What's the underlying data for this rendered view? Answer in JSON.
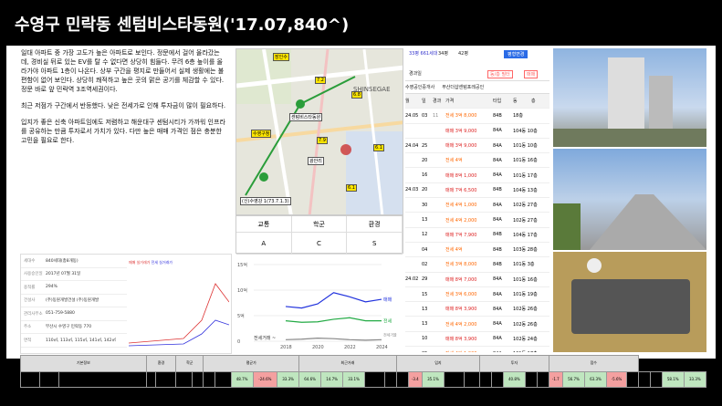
{
  "header": {
    "title": "수영구 민락동 센텀비스타동원('17.07,840^)"
  },
  "description": [
    "일대 아파트 중 가장 고도가 높은 아파트로 보인다. 정문에서 걸어 올라갔는데, 경비실 뒤로 있는 EV를 탈 수 없다면 상당히 힘들다. 무려 6층 높이를 올라가야 아파트 1층이 나온다. 상부 구간을 평지로 만들어서 실제 생활에는 불편함이 없어 보인다. 상당히 쾌적하고 높은 곳의 맑은 공기를 체감할 수 있다. 정문 바로 앞 민락역 3조역세권이다.",
    "최근 저점가 구간에서 반등했다. 낮은 전세가로 인해 투자금이 많이 필요하다.",
    "입지가 좋은 신축 아파트임에도 저렴하고 해운대구 센텀시티가 가까워 인프라를 공유하는 만큼 투자로서 가치가 있다. 다만 높은 매매 가격인 점은 충분한 고민을 필요로 한다."
  ],
  "map": {
    "tags": [
      {
        "id": "t1",
        "text": "장인수"
      },
      {
        "id": "t2",
        "text": "7.2"
      },
      {
        "id": "t3",
        "text": "6.8"
      },
      {
        "id": "t4",
        "text": "수영구청"
      },
      {
        "id": "t5",
        "text": "7.9"
      },
      {
        "id": "t6",
        "text": "센텀비스타동원"
      },
      {
        "id": "t7",
        "text": "6.1"
      },
      {
        "id": "t8",
        "text": "6.1"
      },
      {
        "id": "t9",
        "text": "(신)수영강 1(73.7.1.3)"
      },
      {
        "id": "t10",
        "text": "광안리"
      }
    ],
    "brand": "SHINSEGAE"
  },
  "grade": {
    "headers": [
      "교통",
      "학군",
      "환경"
    ],
    "values": [
      "A",
      "C",
      "S"
    ]
  },
  "deals": {
    "tabs": [
      "33평 661세대",
      "34평",
      "42평"
    ],
    "button": "평형변경",
    "filter": "경과일",
    "recommend": "동/층 필터",
    "sale_button": "매매",
    "realtors": [
      "수영공인중개사",
      "부산더샵센텀포레공인"
    ],
    "cols": [
      "월",
      "일",
      "경과",
      "가격",
      "타입",
      "동",
      "층"
    ],
    "rows": [
      {
        "d": "24.05",
        "day": "03",
        "ag": "11",
        "t": "전세",
        "p": "3억 8,000",
        "ty": "84B",
        "f": "18층"
      },
      {
        "d": "",
        "day": "",
        "ag": "",
        "t": "매매",
        "p": "3억 9,000",
        "ty": "84A",
        "f": "104동 10층"
      },
      {
        "d": "24.04",
        "day": "25",
        "ag": "",
        "t": "매매",
        "p": "3억 9,000",
        "ty": "84A",
        "f": "101동 10층"
      },
      {
        "d": "",
        "day": "20",
        "ag": "",
        "t": "전세",
        "p": "4억",
        "ty": "84A",
        "f": "101동 16층"
      },
      {
        "d": "",
        "day": "16",
        "ag": "",
        "t": "매매",
        "p": "8억 1,000",
        "ty": "84A",
        "f": "101동 17층"
      },
      {
        "d": "24.03",
        "day": "20",
        "ag": "",
        "t": "매매",
        "p": "7억 6,500",
        "ty": "84B",
        "f": "104동 13층"
      },
      {
        "d": "",
        "day": "30",
        "ag": "",
        "t": "전세",
        "p": "4억 1,000",
        "ty": "84A",
        "f": "102동 27층"
      },
      {
        "d": "",
        "day": "13",
        "ag": "",
        "t": "전세",
        "p": "4억 2,000",
        "ty": "84A",
        "f": "102동 27층"
      },
      {
        "d": "",
        "day": "12",
        "ag": "",
        "t": "매매",
        "p": "7억 7,900",
        "ty": "84B",
        "f": "104동 17층"
      },
      {
        "d": "",
        "day": "04",
        "ag": "",
        "t": "전세",
        "p": "4억",
        "ty": "84B",
        "f": "103동 28층"
      },
      {
        "d": "",
        "day": "02",
        "ag": "",
        "t": "전세",
        "p": "3억 8,000",
        "ty": "84B",
        "f": "101동 3층"
      },
      {
        "d": "24.02",
        "day": "29",
        "ag": "",
        "t": "매매",
        "p": "8억 7,000",
        "ty": "84A",
        "f": "101동 16층"
      },
      {
        "d": "",
        "day": "15",
        "ag": "",
        "t": "전세",
        "p": "3억 6,000",
        "ty": "84A",
        "f": "101동 19층"
      },
      {
        "d": "",
        "day": "13",
        "ag": "",
        "t": "매매",
        "p": "8억 3,900",
        "ty": "84A",
        "f": "102동 26층"
      },
      {
        "d": "",
        "day": "13",
        "ag": "",
        "t": "전세",
        "p": "4억 2,000",
        "ty": "84A",
        "f": "102동 26층"
      },
      {
        "d": "",
        "day": "10",
        "ag": "",
        "t": "매매",
        "p": "8억 3,900",
        "ty": "84A",
        "f": "102동 24층"
      },
      {
        "d": "",
        "day": "05",
        "ag": "",
        "t": "전세",
        "p": "4억 1,000",
        "ty": "84A",
        "f": "101동 17층"
      },
      {
        "d": "",
        "day": "",
        "ag": "",
        "t": "전세",
        "p": "3억 5,000",
        "ty": "84B",
        "f": "104동 13층"
      }
    ]
  },
  "info": {
    "rows": [
      {
        "k": "세대수",
        "v": "840세대(총8개동)",
        "k2": "저/최고층",
        "v2": "25층/29층"
      },
      {
        "k": "사용승인일",
        "v": "2017년 07월 31일",
        "k2": "용적률",
        "v2": ""
      },
      {
        "k": "용적률",
        "v": "294%",
        "k2": "건폐율",
        "v2": "16%"
      },
      {
        "k": "건설사",
        "v": "(주)동원개발건설 (주)동원개발",
        "k2": "",
        "v2": ""
      },
      {
        "k": "관리사무소",
        "v": "051-759-5880",
        "k2": "",
        "v2": ""
      },
      {
        "k": "주소",
        "v": "부산시 수영구 민락동 770",
        "k2": "",
        "v2": ""
      },
      {
        "k": "면적",
        "v": "110㎡, 113㎡, 115㎡, 141㎡, 142㎡",
        "k2": "",
        "v2": ""
      }
    ],
    "legend": [
      "매매 실거래가",
      "전세 실거래가"
    ]
  },
  "chart_data": {
    "type": "line",
    "x": [
      2016,
      2017,
      2018,
      2019,
      2020,
      2021,
      2022,
      2023,
      2024
    ],
    "ytick_labels": [
      "0",
      "5억",
      "10억",
      "15억"
    ],
    "xtick_labels": [
      "2018",
      "2020",
      "2022",
      "2024"
    ],
    "ylim": [
      0,
      15
    ],
    "series": [
      {
        "name": "매매",
        "values": [
          null,
          null,
          6.8,
          6.5,
          7.3,
          9.5,
          8.7,
          7.7,
          8.2
        ]
      },
      {
        "name": "전세",
        "values": [
          null,
          null,
          4.0,
          3.7,
          3.8,
          4.3,
          4.6,
          4.0,
          4.0
        ]
      },
      {
        "name": "",
        "values": [
          null,
          null,
          0.3,
          0.4,
          0.6,
          0.5,
          0.3,
          0.2,
          0.3
        ]
      }
    ],
    "colors": [
      "#2233dd",
      "#22aa44",
      "#888888"
    ],
    "legend_texts": [
      "전세가율"
    ],
    "bottom_label": "전세거래 ~"
  },
  "bottom_table": {
    "header1": [
      "기본정보",
      "환경",
      "학군",
      "평균가",
      "최근거래",
      "입지",
      "투자",
      "점수"
    ],
    "row": [
      "수영구",
      "민락동",
      "센텀비스타동원('17.07,840^)",
      "33",
      "113.7",
      "84.8",
      "7.8",
      "3.8",
      "43.1",
      "48.7%",
      "-24.6%",
      "33.3%",
      "64.6%",
      "14.7%",
      "33.1%",
      "22.11",
      "6.8",
      "8.0",
      "-3.4",
      "35.1%",
      "21.06",
      "10.4",
      "5.1",
      "1.1",
      "40.8%",
      "7.8",
      "8.5",
      "-1.7",
      "56.7%",
      "63.3%",
      "-5.6%",
      "7.8",
      "4.3",
      "3.5",
      "58.1%",
      "33.3%"
    ]
  }
}
